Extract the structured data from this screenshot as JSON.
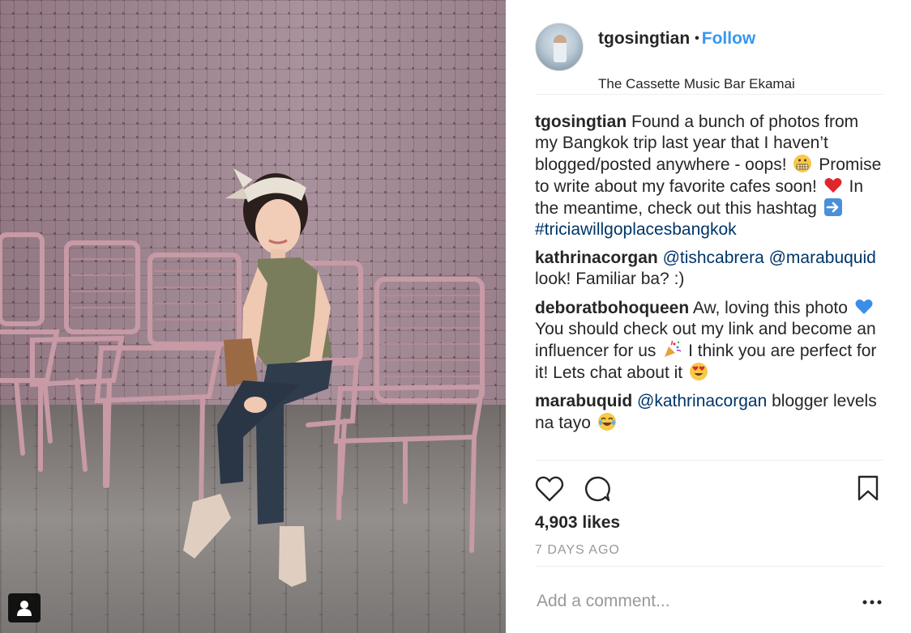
{
  "post": {
    "username": "tgosingtian",
    "separator": "•",
    "follow_label": "Follow",
    "location": "The Cassette Music Bar Ekamai"
  },
  "comments": [
    {
      "username": "tgosingtian",
      "text_parts": [
        "Found a bunch of photos from my Bangkok trip last year that I haven’t blogged/posted anywhere - oops! ",
        " Promise to write about my favorite cafes soon! ",
        " In the meantime, check out this hashtag ",
        " "
      ],
      "emojis": [
        "grimacing-face",
        "red-heart",
        "right-arrow"
      ],
      "hashtag": "#triciawillgoplacesbangkok"
    },
    {
      "username": "kathrinacorgan",
      "mention1": "@tishcabrera",
      "mention2": "@marabuquid",
      "text": " look! Familiar ba? :)"
    },
    {
      "username": "deboratbohoqueen",
      "text_parts": [
        " Aw, loving this photo ",
        "You should check out my link and become an influencer for us ",
        " I think you are perfect for it! Lets chat about it "
      ],
      "emojis": [
        "blue-heart",
        "party-popper",
        "heart-eyes"
      ]
    },
    {
      "username": "marabuquid",
      "mention": "@kathrinacorgan",
      "text": " blogger levels na tayo ",
      "emojis": [
        "tears-of-joy"
      ]
    }
  ],
  "actions": {
    "like_icon": "heart-outline-icon",
    "comment_icon": "speech-bubble-icon",
    "save_icon": "bookmark-icon"
  },
  "likes": "4,903 likes",
  "time_ago": "7 DAYS AGO",
  "add_comment_placeholder": "Add a comment...",
  "more_icon": "ellipsis-icon",
  "colors": {
    "link_blue": "#3897f0",
    "mention_blue": "#003569",
    "text": "#262626",
    "muted": "#999999",
    "divider": "#efefef"
  }
}
